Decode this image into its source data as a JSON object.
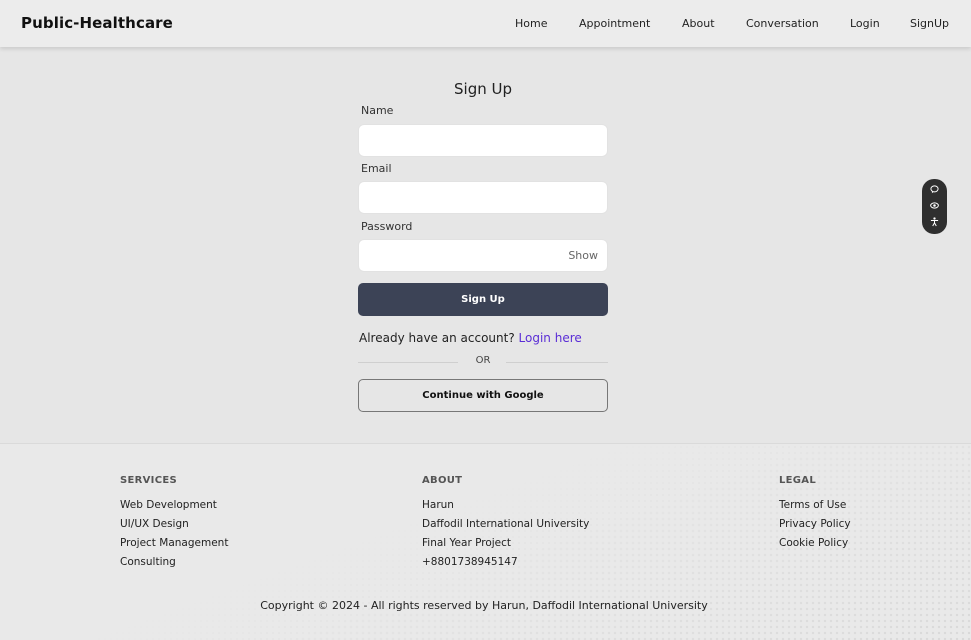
{
  "navbar": {
    "brand": "Public-Healthcare",
    "links": [
      "Home",
      "Appointment",
      "About",
      "Conversation",
      "Login",
      "SignUp"
    ]
  },
  "form": {
    "title": "Sign Up",
    "name_label": "Name",
    "name_value": "",
    "email_label": "Email",
    "email_value": "",
    "password_label": "Password",
    "password_value": "",
    "show_label": "Show",
    "submit_label": "Sign Up",
    "already_text": "Already have an account?",
    "login_link": "Login here",
    "or_text": "OR",
    "google_label": "Continue with Google"
  },
  "widget": {
    "icons": [
      "chat-icon",
      "eye-icon",
      "accessibility-icon"
    ]
  },
  "footer": {
    "services": {
      "heading": "SERVICES",
      "items": [
        "Web Development",
        "UI/UX Design",
        "Project Management",
        "Consulting"
      ]
    },
    "about": {
      "heading": "ABOUT",
      "items": [
        "Harun",
        "Daffodil International University",
        "Final Year Project",
        "+8801738945147"
      ]
    },
    "legal": {
      "heading": "LEGAL",
      "items": [
        "Terms of Use",
        "Privacy Policy",
        "Cookie Policy"
      ]
    },
    "copyright": "Copyright © 2024 - All rights reserved by Harun, Daffodil International University"
  },
  "colors": {
    "background": "#e6e6e6",
    "primary_button": "#3c4356",
    "link": "#5a2dd6"
  }
}
